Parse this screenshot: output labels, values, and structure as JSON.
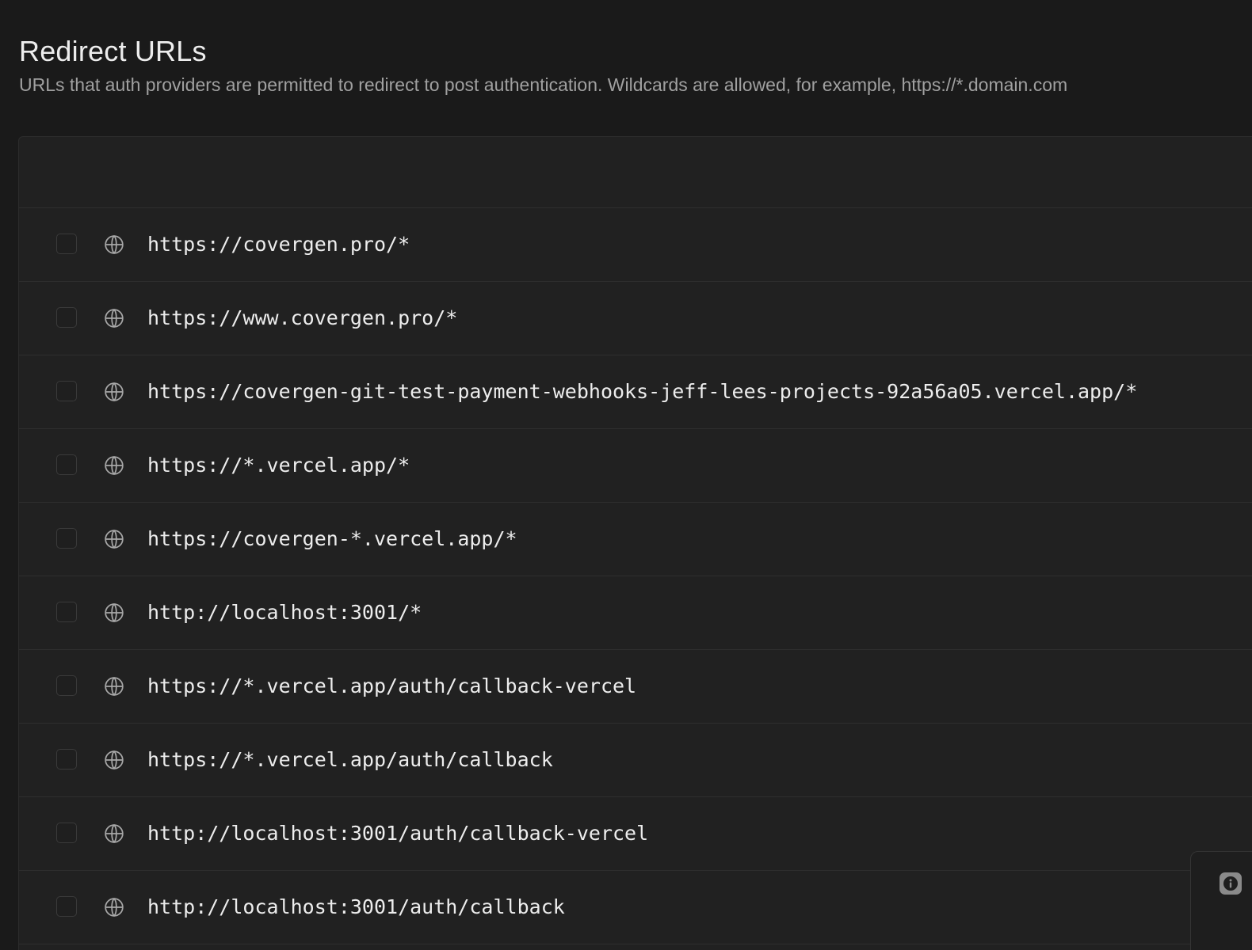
{
  "page": {
    "title": "Redirect URLs",
    "description": "URLs that auth providers are permitted to redirect to post authentication. Wildcards are allowed, for example, https://*.domain.com"
  },
  "redirect_urls": [
    {
      "url": "https://covergen.pro/*",
      "icon": "globe-icon",
      "selected": false
    },
    {
      "url": "https://www.covergen.pro/*",
      "icon": "globe-icon",
      "selected": false
    },
    {
      "url": "https://covergen-git-test-payment-webhooks-jeff-lees-projects-92a56a05.vercel.app/*",
      "icon": "globe-icon",
      "selected": false
    },
    {
      "url": "https://*.vercel.app/*",
      "icon": "globe-icon",
      "selected": false
    },
    {
      "url": "https://covergen-*.vercel.app/*",
      "icon": "globe-icon",
      "selected": false
    },
    {
      "url": "http://localhost:3001/*",
      "icon": "globe-icon",
      "selected": false
    },
    {
      "url": "https://*.vercel.app/auth/callback-vercel",
      "icon": "globe-icon",
      "selected": false
    },
    {
      "url": "https://*.vercel.app/auth/callback",
      "icon": "globe-icon",
      "selected": false
    },
    {
      "url": "http://localhost:3001/auth/callback-vercel",
      "icon": "globe-icon",
      "selected": false
    },
    {
      "url": "http://localhost:3001/auth/callback",
      "icon": "globe-icon",
      "selected": false
    }
  ],
  "widgets": {
    "help_icon": "info-icon"
  },
  "colors": {
    "background": "#1a1a1a",
    "panel": "#212121",
    "border": "#2e2e2e",
    "text": "#ededed",
    "muted_text": "#a0a0a0"
  }
}
